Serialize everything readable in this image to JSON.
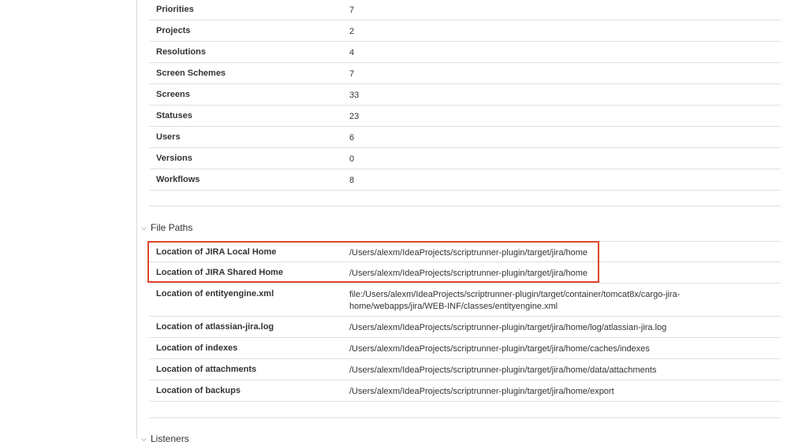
{
  "stats": [
    {
      "label": "Priorities",
      "value": "7"
    },
    {
      "label": "Projects",
      "value": "2"
    },
    {
      "label": "Resolutions",
      "value": "4"
    },
    {
      "label": "Screen Schemes",
      "value": "7"
    },
    {
      "label": "Screens",
      "value": "33"
    },
    {
      "label": "Statuses",
      "value": "23"
    },
    {
      "label": "Users",
      "value": "6"
    },
    {
      "label": "Versions",
      "value": "0"
    },
    {
      "label": "Workflows",
      "value": "8"
    }
  ],
  "file_paths": {
    "title": "File Paths",
    "rows": [
      {
        "label": "Location of JIRA Local Home",
        "value": "/Users/alexm/IdeaProjects/scriptrunner-plugin/target/jira/home"
      },
      {
        "label": "Location of JIRA Shared Home",
        "value": "/Users/alexm/IdeaProjects/scriptrunner-plugin/target/jira/home"
      },
      {
        "label": "Location of entityengine.xml",
        "value": "file:/Users/alexm/IdeaProjects/scriptrunner-plugin/target/container/tomcat8x/cargo-jira-home/webapps/jira/WEB-INF/classes/entityengine.xml"
      },
      {
        "label": "Location of atlassian-jira.log",
        "value": "/Users/alexm/IdeaProjects/scriptrunner-plugin/target/jira/home/log/atlassian-jira.log"
      },
      {
        "label": "Location of indexes",
        "value": "/Users/alexm/IdeaProjects/scriptrunner-plugin/target/jira/home/caches/indexes"
      },
      {
        "label": "Location of attachments",
        "value": "/Users/alexm/IdeaProjects/scriptrunner-plugin/target/jira/home/data/attachments"
      },
      {
        "label": "Location of backups",
        "value": "/Users/alexm/IdeaProjects/scriptrunner-plugin/target/jira/home/export"
      }
    ]
  },
  "listeners": {
    "title": "Listeners"
  },
  "colors": {
    "highlight": "#e0462b",
    "divider": "#dfdfdf"
  },
  "icons": {
    "section_toggle": "chevron-down-icon"
  }
}
